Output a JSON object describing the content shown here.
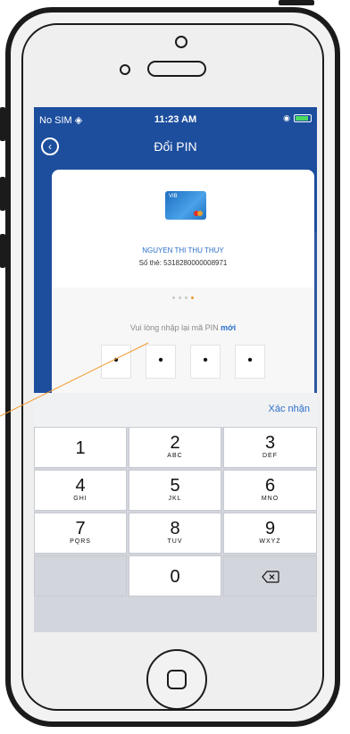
{
  "status_bar": {
    "carrier": "No SIM ◈",
    "time": "11:23 AM"
  },
  "nav": {
    "title": "Đổi PIN",
    "back_icon": "back-circle-icon"
  },
  "card": {
    "brand_mark": "VIB",
    "holder_name": "NGUYEN THI THU THUY",
    "card_number": "Số thẻ: 5318280000008971"
  },
  "pin": {
    "step_total": 4,
    "step_current": 4,
    "prompt_text": "Vui lòng nhập lại mã PIN",
    "prompt_highlight": "mới",
    "digits": [
      "•",
      "•",
      "•",
      "•"
    ]
  },
  "keyboard": {
    "confirm_label": "Xác nhận",
    "keys": [
      {
        "num": "1",
        "letters": ""
      },
      {
        "num": "2",
        "letters": "ABC"
      },
      {
        "num": "3",
        "letters": "DEF"
      },
      {
        "num": "4",
        "letters": "GHI"
      },
      {
        "num": "5",
        "letters": "JKL"
      },
      {
        "num": "6",
        "letters": "MNO"
      },
      {
        "num": "7",
        "letters": "PQRS"
      },
      {
        "num": "8",
        "letters": "TUV"
      },
      {
        "num": "9",
        "letters": "WXYZ"
      },
      {
        "num": "0",
        "letters": ""
      }
    ]
  },
  "colors": {
    "primary": "#1d4e9e",
    "accent": "#2a6fc8",
    "progress_active": "#f29a2e",
    "annotation": "#f29a2e"
  }
}
